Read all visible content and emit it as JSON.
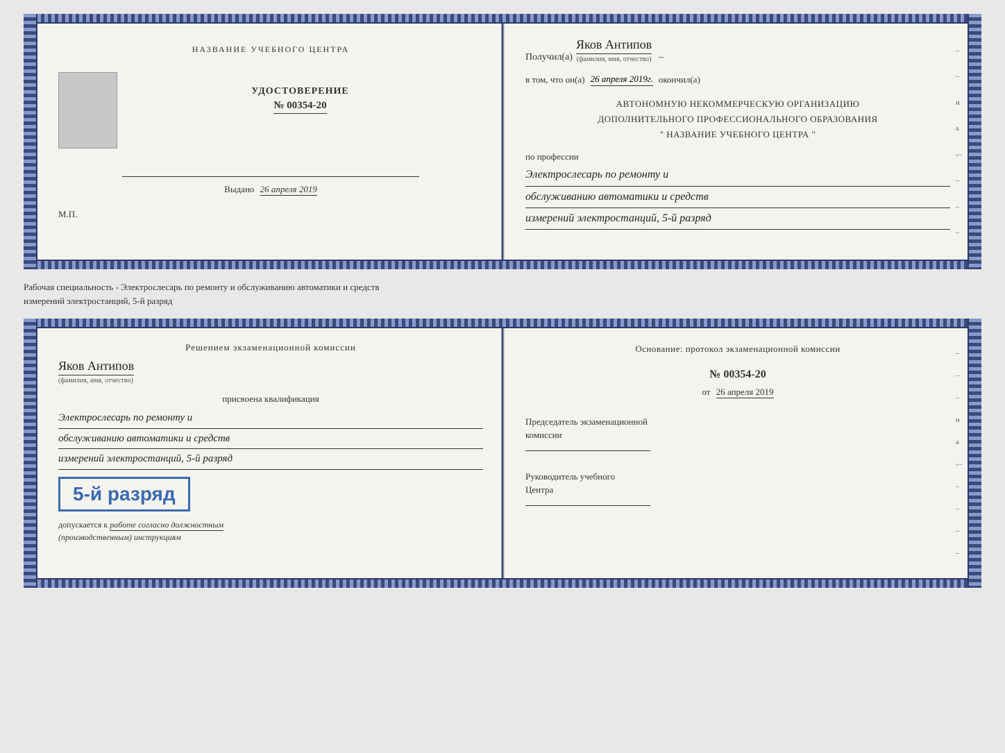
{
  "top_book": {
    "left": {
      "top_title": "НАЗВАНИЕ УЧЕБНОГО ЦЕНТРА",
      "photo_alt": "photo placeholder",
      "udost_title": "УДОСТОВЕРЕНИЕ",
      "udost_number": "№ 00354-20",
      "vydano_label": "Выдано",
      "vydano_date": "26 апреля 2019",
      "mp_label": "М.П."
    },
    "right": {
      "poluchil": "Получил(а)",
      "fio_handwritten": "Яков Антипов",
      "fio_hint": "(фамилия, имя, отчество)",
      "vtom": "в том, что он(а)",
      "vtom_date": "26 апреля 2019г.",
      "okonchil": "окончил(а)",
      "org_line1": "АВТОНОМНУЮ НЕКОММЕРЧЕСКУЮ ОРГАНИЗАЦИЮ",
      "org_line2": "ДОПОЛНИТЕЛЬНОГО ПРОФЕССИОНАЛЬНОГО ОБРАЗОВАНИЯ",
      "org_quote": "\"    НАЗВАНИЕ УЧЕБНОГО ЦЕНТРА    \"",
      "poprofessii": "по профессии",
      "profession_line1": "Электрослесарь по ремонту и",
      "profession_line2": "обслуживанию автоматики и средств",
      "profession_line3": "измерений электростанций, 5-й разряд"
    }
  },
  "middle_label": "Рабочая специальность - Электрослесарь по ремонту и обслуживанию автоматики и средств\nизмерений электростанций, 5-й разряд",
  "bottom_book": {
    "left": {
      "resheniem": "Решением экзаменационной комиссии",
      "fio_handwritten": "Яков Антипов",
      "fio_hint": "(фамилия, имя, отчество)",
      "prisvoena": "присвоена квалификация",
      "kvalif_line1": "Электрослесарь по ремонту и",
      "kvalif_line2": "обслуживанию автоматики и средств",
      "kvalif_line3": "измерений электростанций, 5-й разряд",
      "razryad_badge": "5-й разряд",
      "dopuskaetsya": "допускается к",
      "dopusk_text": "работе согласно должностным",
      "dopusk_text2": "(производственным) инструкциям"
    },
    "right": {
      "osnov_label": "Основание: протокол экзаменационной комиссии",
      "protocol_number": "№  00354-20",
      "ot_label": "от",
      "ot_date": "26 апреля 2019",
      "pred_label": "Председатель экзаменационной",
      "pred_label2": "комиссии",
      "ruk_label": "Руководитель учебного",
      "ruk_label2": "Центра"
    }
  }
}
